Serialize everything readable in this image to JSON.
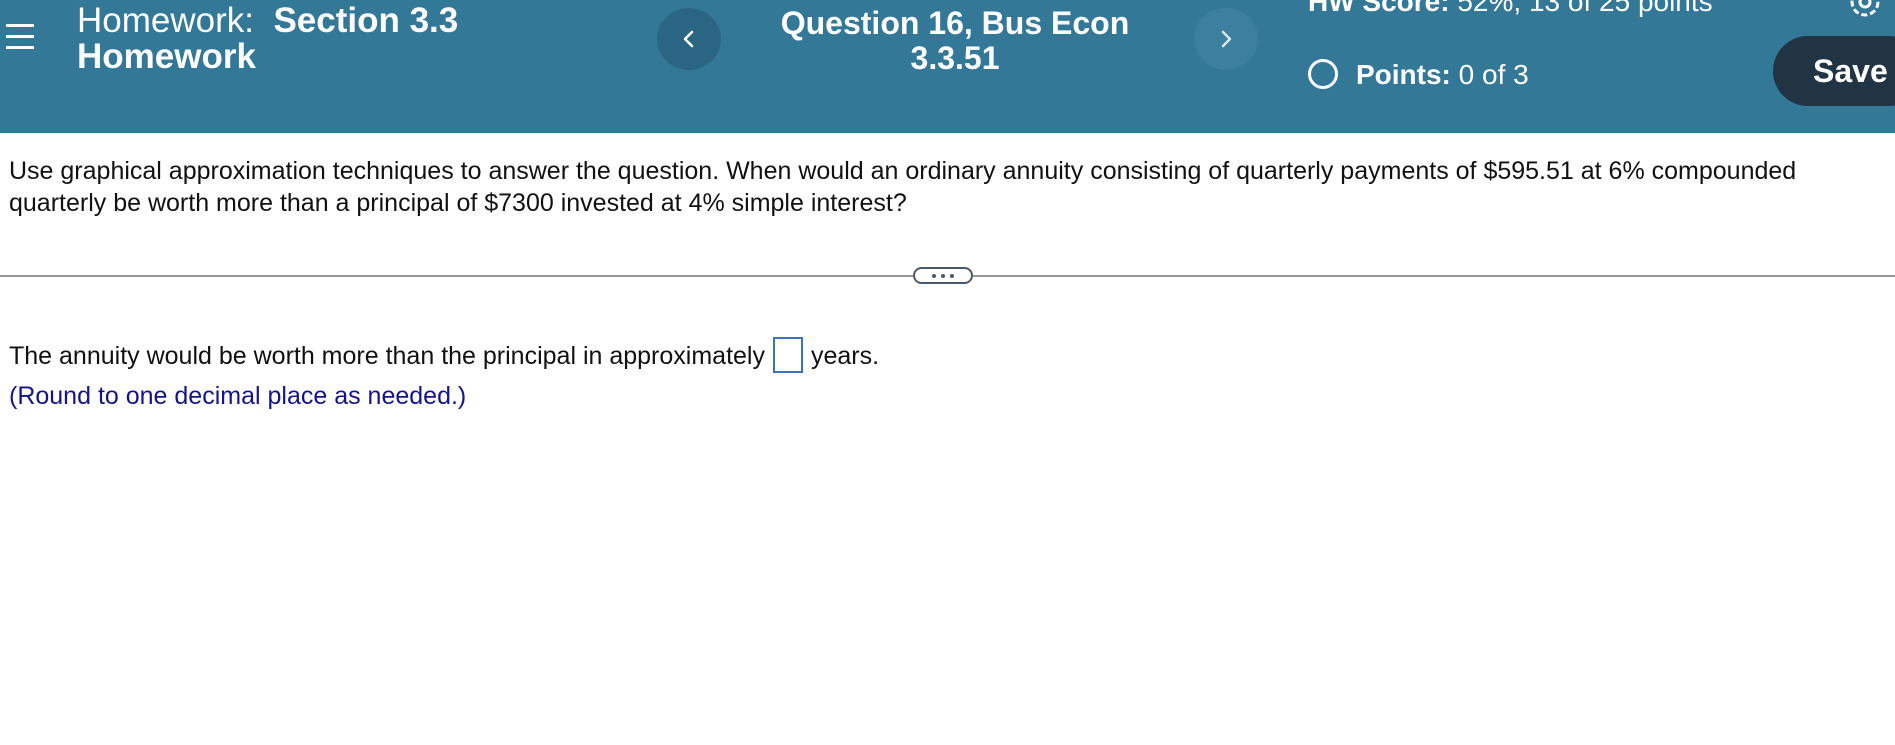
{
  "header": {
    "homework_prefix": "Homework:",
    "homework_name": "Section 3.3 Homework",
    "question_title": "Question 16, Bus Econ 3.3.51",
    "score_label": "HW Score:",
    "score_value": "52%, 13 of 25 points",
    "points_label": "Points:",
    "points_value": "0 of 3",
    "save_label": "Save",
    "icons": {
      "menu": "menu-icon",
      "prev": "chevron-left-icon",
      "next": "chevron-right-icon",
      "status": "circle-icon",
      "settings": "gear-icon"
    },
    "colors": {
      "background": "#347898",
      "save_button": "#203444"
    }
  },
  "question": {
    "text": "Use graphical approximation techniques to answer the question. When would an ordinary annuity consisting of quarterly payments of $595.51 at 6% compounded quarterly be worth more than a principal of $7300 invested at 4% simple interest?"
  },
  "answer": {
    "prefix": "The annuity would be worth more than the principal in approximately",
    "value": "",
    "suffix": "years.",
    "hint": "(Round to one decimal place as needed.)"
  }
}
